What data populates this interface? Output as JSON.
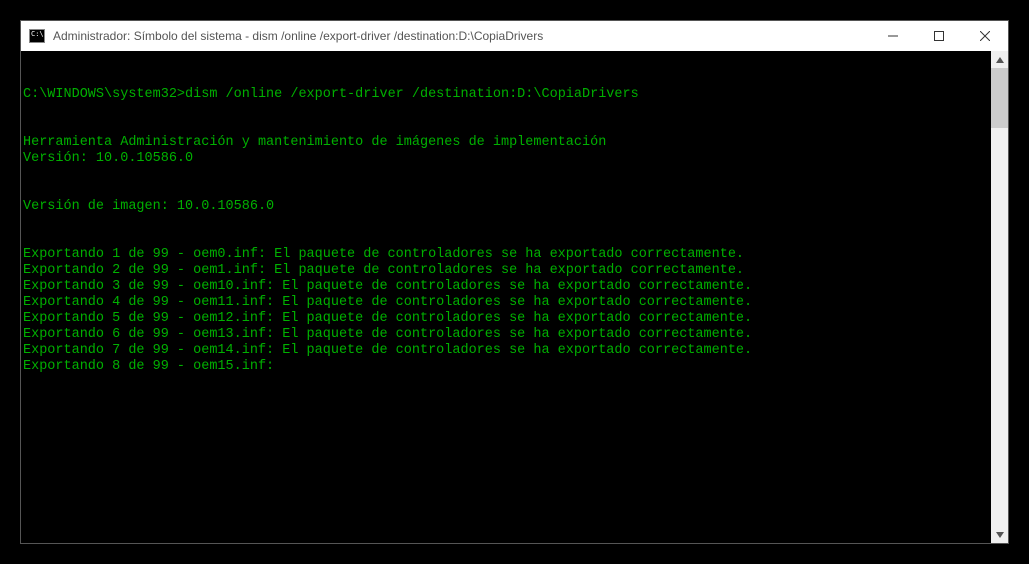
{
  "titlebar": {
    "title": "Administrador: Símbolo del sistema - dism  /online /export-driver /destination:D:\\CopiaDrivers"
  },
  "console": {
    "prompt_path": "C:\\WINDOWS\\system32>",
    "command": "dism /online /export-driver /destination:D:\\CopiaDrivers",
    "tool_header": "Herramienta Administración y mantenimiento de imágenes de implementación",
    "version_line": "Versión: 10.0.10586.0",
    "image_version_line": "Versión de imagen: 10.0.10586.0",
    "export_lines": [
      "Exportando 1 de 99 - oem0.inf: El paquete de controladores se ha exportado correctamente.",
      "Exportando 2 de 99 - oem1.inf: El paquete de controladores se ha exportado correctamente.",
      "Exportando 3 de 99 - oem10.inf: El paquete de controladores se ha exportado correctamente.",
      "Exportando 4 de 99 - oem11.inf: El paquete de controladores se ha exportado correctamente.",
      "Exportando 5 de 99 - oem12.inf: El paquete de controladores se ha exportado correctamente.",
      "Exportando 6 de 99 - oem13.inf: El paquete de controladores se ha exportado correctamente.",
      "Exportando 7 de 99 - oem14.inf: El paquete de controladores se ha exportado correctamente.",
      "Exportando 8 de 99 - oem15.inf:"
    ]
  },
  "colors": {
    "console_bg": "#000000",
    "console_fg": "#00b000",
    "titlebar_bg": "#ffffff",
    "titlebar_fg": "#555555"
  }
}
